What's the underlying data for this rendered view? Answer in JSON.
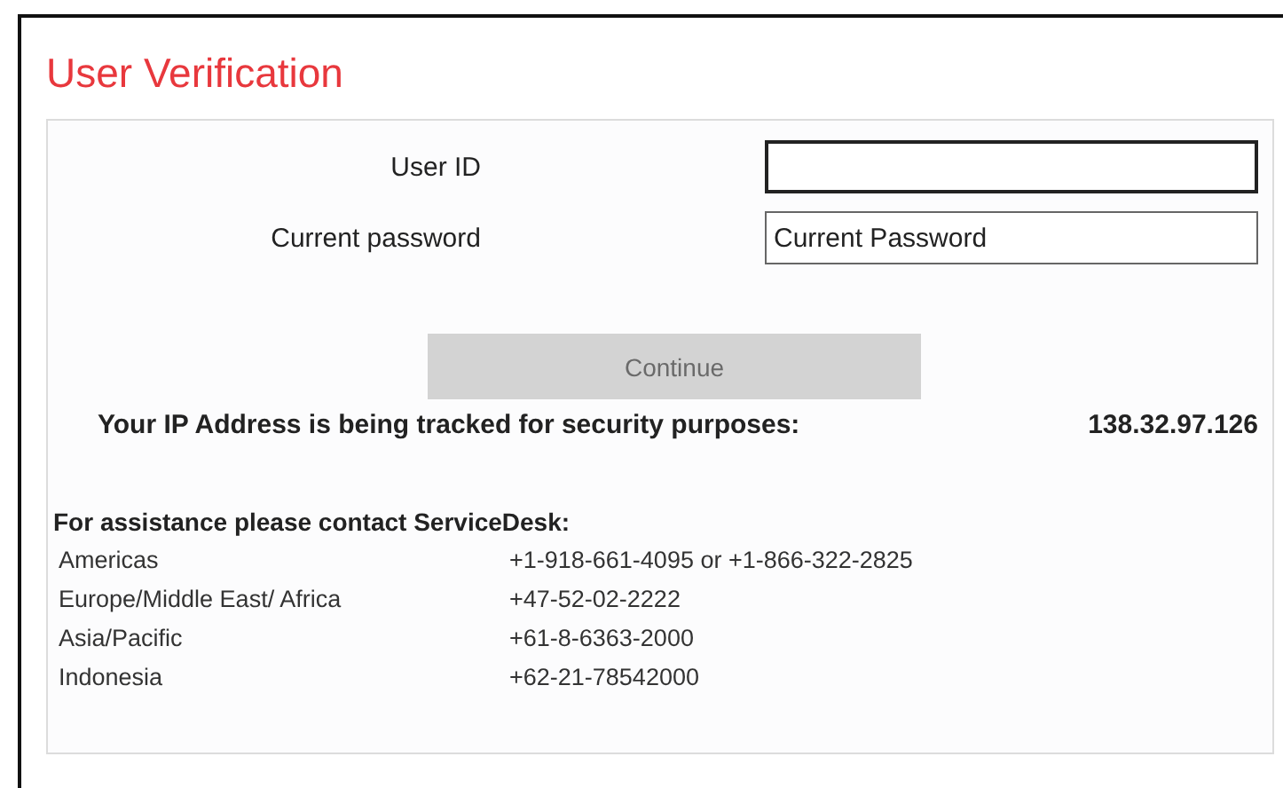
{
  "title": "User Verification",
  "fields": [
    {
      "label": "User ID"
    },
    {
      "label": "Current password",
      "value": "Current Password"
    }
  ],
  "continue_button": {
    "label": "Continue",
    "disabled": true
  },
  "ip_notice": {
    "text": "Your IP Address is being tracked for security purposes:",
    "address": "138.32.97.126"
  },
  "assistance": {
    "heading": "For assistance please contact ServiceDesk:",
    "contacts": [
      {
        "region": "Americas",
        "phone": "+1-918-661-4095 or +1-866-322-2825"
      },
      {
        "region": "Europe/Middle East/ Africa",
        "phone": "+47-52-02-2222"
      },
      {
        "region": "Asia/Pacific",
        "phone": "+61-8-6363-2000"
      },
      {
        "region": "Indonesia",
        "phone": "+62-21-78542000"
      }
    ]
  }
}
